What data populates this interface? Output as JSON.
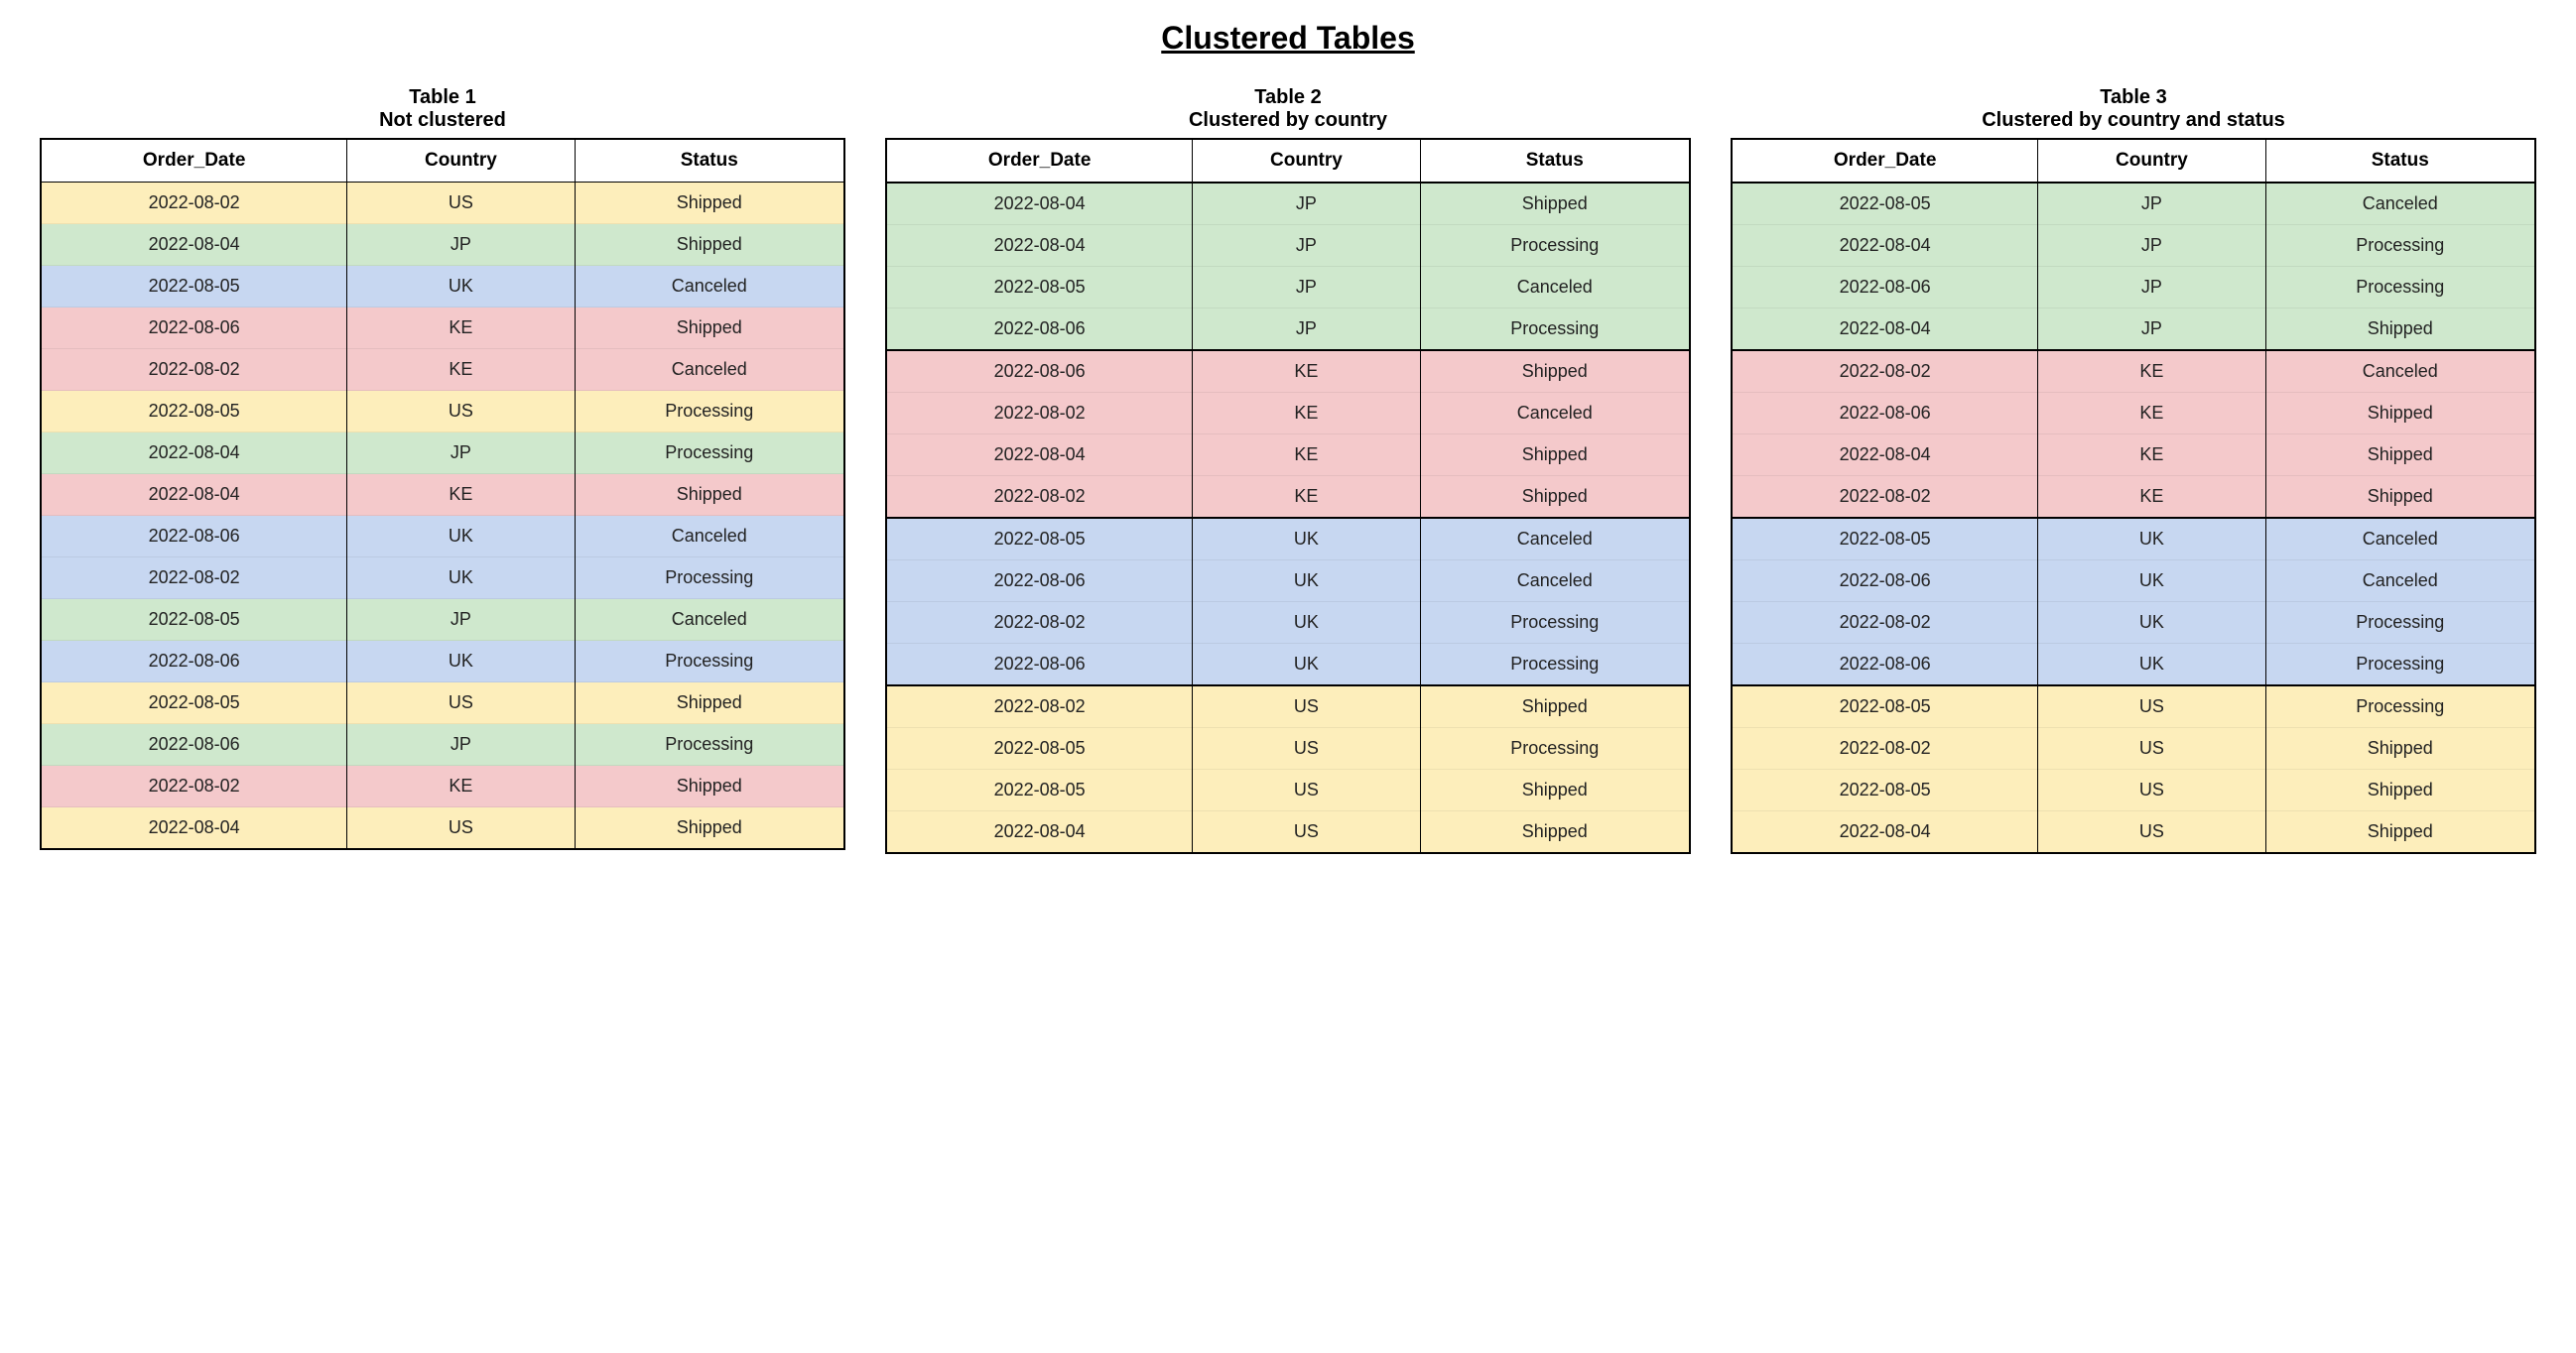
{
  "title": "Clustered Tables",
  "colors": {
    "US": "#fdeebb",
    "JP": "#cfe8cd",
    "UK": "#c7d7f1",
    "KE": "#f4c9cb"
  },
  "columns": [
    "Order_Date",
    "Country",
    "Status"
  ],
  "tables": [
    {
      "name": "Table 1",
      "subtitle": "Not clustered",
      "rows": [
        {
          "order_date": "2022-08-02",
          "country": "US",
          "status": "Shipped"
        },
        {
          "order_date": "2022-08-04",
          "country": "JP",
          "status": "Shipped"
        },
        {
          "order_date": "2022-08-05",
          "country": "UK",
          "status": "Canceled"
        },
        {
          "order_date": "2022-08-06",
          "country": "KE",
          "status": "Shipped"
        },
        {
          "order_date": "2022-08-02",
          "country": "KE",
          "status": "Canceled"
        },
        {
          "order_date": "2022-08-05",
          "country": "US",
          "status": "Processing"
        },
        {
          "order_date": "2022-08-04",
          "country": "JP",
          "status": "Processing"
        },
        {
          "order_date": "2022-08-04",
          "country": "KE",
          "status": "Shipped"
        },
        {
          "order_date": "2022-08-06",
          "country": "UK",
          "status": "Canceled"
        },
        {
          "order_date": "2022-08-02",
          "country": "UK",
          "status": "Processing"
        },
        {
          "order_date": "2022-08-05",
          "country": "JP",
          "status": "Canceled"
        },
        {
          "order_date": "2022-08-06",
          "country": "UK",
          "status": "Processing"
        },
        {
          "order_date": "2022-08-05",
          "country": "US",
          "status": "Shipped"
        },
        {
          "order_date": "2022-08-06",
          "country": "JP",
          "status": "Processing"
        },
        {
          "order_date": "2022-08-02",
          "country": "KE",
          "status": "Shipped"
        },
        {
          "order_date": "2022-08-04",
          "country": "US",
          "status": "Shipped"
        }
      ],
      "group_borders": false
    },
    {
      "name": "Table 2",
      "subtitle": "Clustered by country",
      "rows": [
        {
          "order_date": "2022-08-04",
          "country": "JP",
          "status": "Shipped"
        },
        {
          "order_date": "2022-08-04",
          "country": "JP",
          "status": "Processing"
        },
        {
          "order_date": "2022-08-05",
          "country": "JP",
          "status": "Canceled"
        },
        {
          "order_date": "2022-08-06",
          "country": "JP",
          "status": "Processing"
        },
        {
          "order_date": "2022-08-06",
          "country": "KE",
          "status": "Shipped"
        },
        {
          "order_date": "2022-08-02",
          "country": "KE",
          "status": "Canceled"
        },
        {
          "order_date": "2022-08-04",
          "country": "KE",
          "status": "Shipped"
        },
        {
          "order_date": "2022-08-02",
          "country": "KE",
          "status": "Shipped"
        },
        {
          "order_date": "2022-08-05",
          "country": "UK",
          "status": "Canceled"
        },
        {
          "order_date": "2022-08-06",
          "country": "UK",
          "status": "Canceled"
        },
        {
          "order_date": "2022-08-02",
          "country": "UK",
          "status": "Processing"
        },
        {
          "order_date": "2022-08-06",
          "country": "UK",
          "status": "Processing"
        },
        {
          "order_date": "2022-08-02",
          "country": "US",
          "status": "Shipped"
        },
        {
          "order_date": "2022-08-05",
          "country": "US",
          "status": "Processing"
        },
        {
          "order_date": "2022-08-05",
          "country": "US",
          "status": "Shipped"
        },
        {
          "order_date": "2022-08-04",
          "country": "US",
          "status": "Shipped"
        }
      ],
      "group_borders": true
    },
    {
      "name": "Table 3",
      "subtitle": "Clustered by country and status",
      "rows": [
        {
          "order_date": "2022-08-05",
          "country": "JP",
          "status": "Canceled"
        },
        {
          "order_date": "2022-08-04",
          "country": "JP",
          "status": "Processing"
        },
        {
          "order_date": "2022-08-06",
          "country": "JP",
          "status": "Processing"
        },
        {
          "order_date": "2022-08-04",
          "country": "JP",
          "status": "Shipped"
        },
        {
          "order_date": "2022-08-02",
          "country": "KE",
          "status": "Canceled"
        },
        {
          "order_date": "2022-08-06",
          "country": "KE",
          "status": "Shipped"
        },
        {
          "order_date": "2022-08-04",
          "country": "KE",
          "status": "Shipped"
        },
        {
          "order_date": "2022-08-02",
          "country": "KE",
          "status": "Shipped"
        },
        {
          "order_date": "2022-08-05",
          "country": "UK",
          "status": "Canceled"
        },
        {
          "order_date": "2022-08-06",
          "country": "UK",
          "status": "Canceled"
        },
        {
          "order_date": "2022-08-02",
          "country": "UK",
          "status": "Processing"
        },
        {
          "order_date": "2022-08-06",
          "country": "UK",
          "status": "Processing"
        },
        {
          "order_date": "2022-08-05",
          "country": "US",
          "status": "Processing"
        },
        {
          "order_date": "2022-08-02",
          "country": "US",
          "status": "Shipped"
        },
        {
          "order_date": "2022-08-05",
          "country": "US",
          "status": "Shipped"
        },
        {
          "order_date": "2022-08-04",
          "country": "US",
          "status": "Shipped"
        }
      ],
      "group_borders": true
    }
  ]
}
